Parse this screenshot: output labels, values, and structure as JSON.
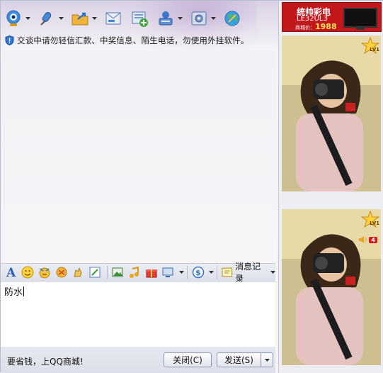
{
  "toolbar": {
    "items": [
      {
        "icon": "video-call-icon"
      },
      {
        "icon": "voice-call-icon"
      },
      {
        "icon": "send-file-icon"
      },
      {
        "icon": "email-icon"
      },
      {
        "icon": "app-add-icon"
      },
      {
        "icon": "remote-assist-icon"
      },
      {
        "icon": "settings-icon"
      },
      {
        "icon": "globe-icon"
      }
    ]
  },
  "notice": {
    "text": "交谈中请勿轻信汇款、中奖信息、陌生电话，勿使用外挂软件。"
  },
  "format_bar": {
    "history_label": "消息记录"
  },
  "input": {
    "value": "防水"
  },
  "bottom": {
    "promo": "要省钱，上QQ商城!",
    "close_label": "关闭(C)",
    "send_label": "发送(S)"
  },
  "ad": {
    "title": "统帅彩电",
    "model": "LE32UL3",
    "price_label": "商城价：",
    "price": "1988"
  },
  "avatars": {
    "level": "LV1",
    "unread_count": "4"
  },
  "colors": {
    "ad_red": "#c4171c",
    "price_yellow": "#ffe34a"
  }
}
